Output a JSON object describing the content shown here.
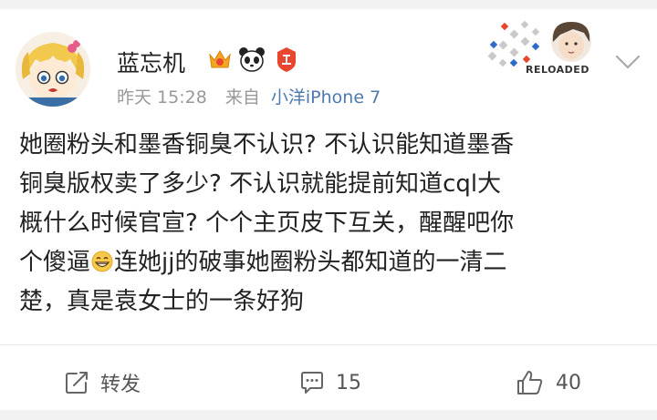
{
  "post": {
    "user": {
      "name": "蓝忘机"
    },
    "time": "昨天 15:28",
    "source_prefix": "来自",
    "source": "小洋iPhone 7",
    "cover_text": "RELOADED",
    "content_lines": [
      "她圈粉头和墨香铜臭不认识? 不认识能知道墨香",
      "铜臭版权卖了多少? 不认识就能提前知道cql大",
      "概什么时候官宣? 个个主页皮下互关，醒醒吧你",
      {
        "before": "个傻逼",
        "after": "连她jj的破事她圈粉头都知道的一清二"
      },
      "楚，真是袁女士的一条好狗"
    ],
    "actions": {
      "repost": "转发",
      "comment": "15",
      "like": "40"
    }
  },
  "icons": {
    "vip": "vip-crown-icon",
    "panda": "panda-badge-icon",
    "red": "red-badge-icon",
    "chevron": "chevron-down-icon",
    "emoji": "grinning-emoji-icon",
    "repost": "repost-icon",
    "comment": "comment-icon",
    "like": "like-icon"
  },
  "colors": {
    "link": "#4e79b0",
    "meta": "#999999",
    "badge_red": "#e8462f",
    "badge_gold": "#f5a623"
  }
}
